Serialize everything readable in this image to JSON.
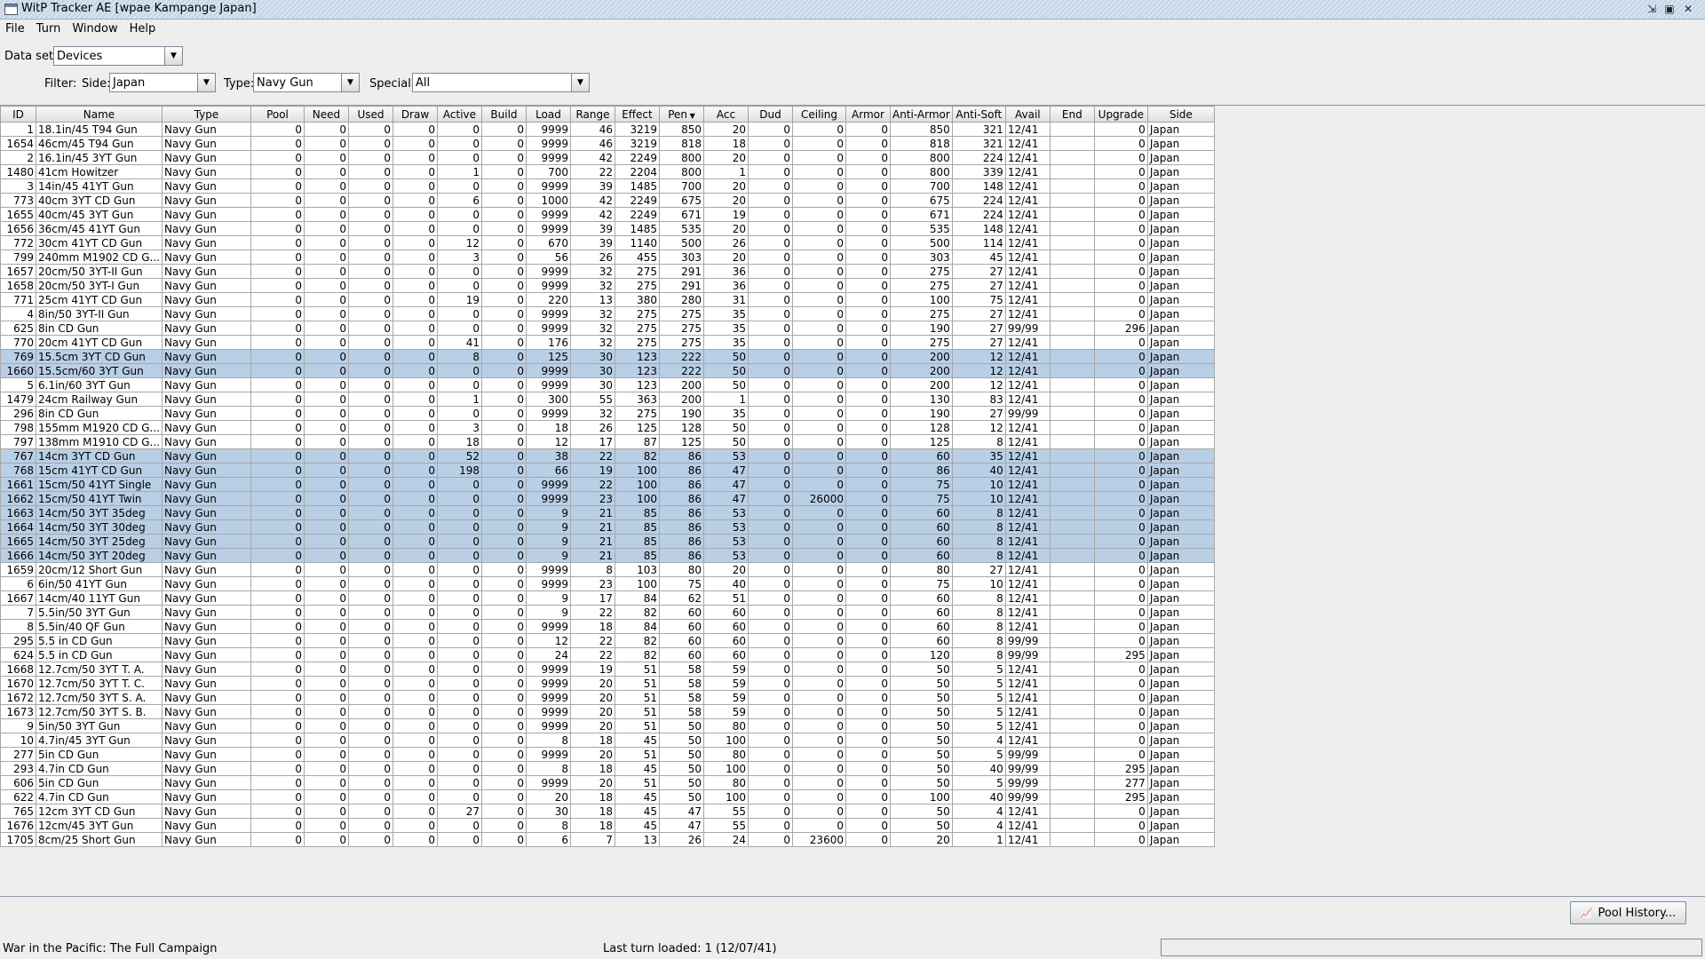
{
  "window": {
    "title": "WitP Tracker AE [wpae Kampange Japan]",
    "menus": [
      "File",
      "Turn",
      "Window",
      "Help"
    ]
  },
  "filters": {
    "dataset_label": "Data set:",
    "dataset_value": "Devices",
    "filter_label": "Filter:",
    "side_label": "Side:",
    "side_value": "Japan",
    "type_label": "Type:",
    "type_value": "Navy Gun",
    "special_label": "Special:",
    "special_value": "All"
  },
  "table": {
    "sort_column": "Pen",
    "columns": [
      "ID",
      "Name",
      "Type",
      "Pool",
      "Need",
      "Used",
      "Draw",
      "Active",
      "Build",
      "Load",
      "Range",
      "Effect",
      "Pen",
      "Acc",
      "Dud",
      "Ceiling",
      "Armor",
      "Anti-Armor",
      "Anti-Soft",
      "Avail",
      "End",
      "Upgrade",
      "Side"
    ],
    "rows": [
      [
        "1",
        "18.1in/45 T94 Gun",
        "Navy Gun",
        "0",
        "0",
        "0",
        "0",
        "0",
        "0",
        "9999",
        "46",
        "3219",
        "850",
        "20",
        "0",
        "0",
        "0",
        "850",
        "321",
        "12/41",
        "",
        "0",
        "Japan"
      ],
      [
        "1654",
        "46cm/45 T94 Gun",
        "Navy Gun",
        "0",
        "0",
        "0",
        "0",
        "0",
        "0",
        "9999",
        "46",
        "3219",
        "818",
        "18",
        "0",
        "0",
        "0",
        "818",
        "321",
        "12/41",
        "",
        "0",
        "Japan"
      ],
      [
        "2",
        "16.1in/45 3YT Gun",
        "Navy Gun",
        "0",
        "0",
        "0",
        "0",
        "0",
        "0",
        "9999",
        "42",
        "2249",
        "800",
        "20",
        "0",
        "0",
        "0",
        "800",
        "224",
        "12/41",
        "",
        "0",
        "Japan"
      ],
      [
        "1480",
        "41cm Howitzer",
        "Navy Gun",
        "0",
        "0",
        "0",
        "0",
        "1",
        "0",
        "700",
        "22",
        "2204",
        "800",
        "1",
        "0",
        "0",
        "0",
        "800",
        "339",
        "12/41",
        "",
        "0",
        "Japan"
      ],
      [
        "3",
        "14in/45 41YT Gun",
        "Navy Gun",
        "0",
        "0",
        "0",
        "0",
        "0",
        "0",
        "9999",
        "39",
        "1485",
        "700",
        "20",
        "0",
        "0",
        "0",
        "700",
        "148",
        "12/41",
        "",
        "0",
        "Japan"
      ],
      [
        "773",
        "40cm 3YT CD Gun",
        "Navy Gun",
        "0",
        "0",
        "0",
        "0",
        "6",
        "0",
        "1000",
        "42",
        "2249",
        "675",
        "20",
        "0",
        "0",
        "0",
        "675",
        "224",
        "12/41",
        "",
        "0",
        "Japan"
      ],
      [
        "1655",
        "40cm/45 3YT Gun",
        "Navy Gun",
        "0",
        "0",
        "0",
        "0",
        "0",
        "0",
        "9999",
        "42",
        "2249",
        "671",
        "19",
        "0",
        "0",
        "0",
        "671",
        "224",
        "12/41",
        "",
        "0",
        "Japan"
      ],
      [
        "1656",
        "36cm/45 41YT Gun",
        "Navy Gun",
        "0",
        "0",
        "0",
        "0",
        "0",
        "0",
        "9999",
        "39",
        "1485",
        "535",
        "20",
        "0",
        "0",
        "0",
        "535",
        "148",
        "12/41",
        "",
        "0",
        "Japan"
      ],
      [
        "772",
        "30cm 41YT CD Gun",
        "Navy Gun",
        "0",
        "0",
        "0",
        "0",
        "12",
        "0",
        "670",
        "39",
        "1140",
        "500",
        "26",
        "0",
        "0",
        "0",
        "500",
        "114",
        "12/41",
        "",
        "0",
        "Japan"
      ],
      [
        "799",
        "240mm M1902 CD G...",
        "Navy Gun",
        "0",
        "0",
        "0",
        "0",
        "3",
        "0",
        "56",
        "26",
        "455",
        "303",
        "20",
        "0",
        "0",
        "0",
        "303",
        "45",
        "12/41",
        "",
        "0",
        "Japan"
      ],
      [
        "1657",
        "20cm/50 3YT-II Gun",
        "Navy Gun",
        "0",
        "0",
        "0",
        "0",
        "0",
        "0",
        "9999",
        "32",
        "275",
        "291",
        "36",
        "0",
        "0",
        "0",
        "275",
        "27",
        "12/41",
        "",
        "0",
        "Japan"
      ],
      [
        "1658",
        "20cm/50 3YT-I Gun",
        "Navy Gun",
        "0",
        "0",
        "0",
        "0",
        "0",
        "0",
        "9999",
        "32",
        "275",
        "291",
        "36",
        "0",
        "0",
        "0",
        "275",
        "27",
        "12/41",
        "",
        "0",
        "Japan"
      ],
      [
        "771",
        "25cm 41YT CD Gun",
        "Navy Gun",
        "0",
        "0",
        "0",
        "0",
        "19",
        "0",
        "220",
        "13",
        "380",
        "280",
        "31",
        "0",
        "0",
        "0",
        "100",
        "75",
        "12/41",
        "",
        "0",
        "Japan"
      ],
      [
        "4",
        "8in/50 3YT-II Gun",
        "Navy Gun",
        "0",
        "0",
        "0",
        "0",
        "0",
        "0",
        "9999",
        "32",
        "275",
        "275",
        "35",
        "0",
        "0",
        "0",
        "275",
        "27",
        "12/41",
        "",
        "0",
        "Japan"
      ],
      [
        "625",
        "8in CD Gun",
        "Navy Gun",
        "0",
        "0",
        "0",
        "0",
        "0",
        "0",
        "9999",
        "32",
        "275",
        "275",
        "35",
        "0",
        "0",
        "0",
        "190",
        "27",
        "99/99",
        "",
        "296",
        "Japan"
      ],
      [
        "770",
        "20cm 41YT CD Gun",
        "Navy Gun",
        "0",
        "0",
        "0",
        "0",
        "41",
        "0",
        "176",
        "32",
        "275",
        "275",
        "35",
        "0",
        "0",
        "0",
        "275",
        "27",
        "12/41",
        "",
        "0",
        "Japan"
      ],
      [
        "769",
        "15.5cm 3YT CD Gun",
        "Navy Gun",
        "0",
        "0",
        "0",
        "0",
        "8",
        "0",
        "125",
        "30",
        "123",
        "222",
        "50",
        "0",
        "0",
        "0",
        "200",
        "12",
        "12/41",
        "",
        "0",
        "Japan"
      ],
      [
        "1660",
        "15.5cm/60 3YT Gun",
        "Navy Gun",
        "0",
        "0",
        "0",
        "0",
        "0",
        "0",
        "9999",
        "30",
        "123",
        "222",
        "50",
        "0",
        "0",
        "0",
        "200",
        "12",
        "12/41",
        "",
        "0",
        "Japan"
      ],
      [
        "5",
        "6.1in/60 3YT Gun",
        "Navy Gun",
        "0",
        "0",
        "0",
        "0",
        "0",
        "0",
        "9999",
        "30",
        "123",
        "200",
        "50",
        "0",
        "0",
        "0",
        "200",
        "12",
        "12/41",
        "",
        "0",
        "Japan"
      ],
      [
        "1479",
        "24cm Railway Gun",
        "Navy Gun",
        "0",
        "0",
        "0",
        "0",
        "1",
        "0",
        "300",
        "55",
        "363",
        "200",
        "1",
        "0",
        "0",
        "0",
        "130",
        "83",
        "12/41",
        "",
        "0",
        "Japan"
      ],
      [
        "296",
        "8in CD Gun",
        "Navy Gun",
        "0",
        "0",
        "0",
        "0",
        "0",
        "0",
        "9999",
        "32",
        "275",
        "190",
        "35",
        "0",
        "0",
        "0",
        "190",
        "27",
        "99/99",
        "",
        "0",
        "Japan"
      ],
      [
        "798",
        "155mm M1920 CD G...",
        "Navy Gun",
        "0",
        "0",
        "0",
        "0",
        "3",
        "0",
        "18",
        "26",
        "125",
        "128",
        "50",
        "0",
        "0",
        "0",
        "128",
        "12",
        "12/41",
        "",
        "0",
        "Japan"
      ],
      [
        "797",
        "138mm M1910 CD G...",
        "Navy Gun",
        "0",
        "0",
        "0",
        "0",
        "18",
        "0",
        "12",
        "17",
        "87",
        "125",
        "50",
        "0",
        "0",
        "0",
        "125",
        "8",
        "12/41",
        "",
        "0",
        "Japan"
      ],
      [
        "767",
        "14cm 3YT CD Gun",
        "Navy Gun",
        "0",
        "0",
        "0",
        "0",
        "52",
        "0",
        "38",
        "22",
        "82",
        "86",
        "53",
        "0",
        "0",
        "0",
        "60",
        "35",
        "12/41",
        "",
        "0",
        "Japan"
      ],
      [
        "768",
        "15cm 41YT CD Gun",
        "Navy Gun",
        "0",
        "0",
        "0",
        "0",
        "198",
        "0",
        "66",
        "19",
        "100",
        "86",
        "47",
        "0",
        "0",
        "0",
        "86",
        "40",
        "12/41",
        "",
        "0",
        "Japan"
      ],
      [
        "1661",
        "15cm/50 41YT Single",
        "Navy Gun",
        "0",
        "0",
        "0",
        "0",
        "0",
        "0",
        "9999",
        "22",
        "100",
        "86",
        "47",
        "0",
        "0",
        "0",
        "75",
        "10",
        "12/41",
        "",
        "0",
        "Japan"
      ],
      [
        "1662",
        "15cm/50 41YT Twin",
        "Navy Gun",
        "0",
        "0",
        "0",
        "0",
        "0",
        "0",
        "9999",
        "23",
        "100",
        "86",
        "47",
        "0",
        "26000",
        "0",
        "75",
        "10",
        "12/41",
        "",
        "0",
        "Japan"
      ],
      [
        "1663",
        "14cm/50 3YT 35deg",
        "Navy Gun",
        "0",
        "0",
        "0",
        "0",
        "0",
        "0",
        "9",
        "21",
        "85",
        "86",
        "53",
        "0",
        "0",
        "0",
        "60",
        "8",
        "12/41",
        "",
        "0",
        "Japan"
      ],
      [
        "1664",
        "14cm/50 3YT 30deg",
        "Navy Gun",
        "0",
        "0",
        "0",
        "0",
        "0",
        "0",
        "9",
        "21",
        "85",
        "86",
        "53",
        "0",
        "0",
        "0",
        "60",
        "8",
        "12/41",
        "",
        "0",
        "Japan"
      ],
      [
        "1665",
        "14cm/50 3YT 25deg",
        "Navy Gun",
        "0",
        "0",
        "0",
        "0",
        "0",
        "0",
        "9",
        "21",
        "85",
        "86",
        "53",
        "0",
        "0",
        "0",
        "60",
        "8",
        "12/41",
        "",
        "0",
        "Japan"
      ],
      [
        "1666",
        "14cm/50 3YT 20deg",
        "Navy Gun",
        "0",
        "0",
        "0",
        "0",
        "0",
        "0",
        "9",
        "21",
        "85",
        "86",
        "53",
        "0",
        "0",
        "0",
        "60",
        "8",
        "12/41",
        "",
        "0",
        "Japan"
      ],
      [
        "1659",
        "20cm/12 Short Gun",
        "Navy Gun",
        "0",
        "0",
        "0",
        "0",
        "0",
        "0",
        "9999",
        "8",
        "103",
        "80",
        "20",
        "0",
        "0",
        "0",
        "80",
        "27",
        "12/41",
        "",
        "0",
        "Japan"
      ],
      [
        "6",
        "6in/50 41YT Gun",
        "Navy Gun",
        "0",
        "0",
        "0",
        "0",
        "0",
        "0",
        "9999",
        "23",
        "100",
        "75",
        "40",
        "0",
        "0",
        "0",
        "75",
        "10",
        "12/41",
        "",
        "0",
        "Japan"
      ],
      [
        "1667",
        "14cm/40 11YT Gun",
        "Navy Gun",
        "0",
        "0",
        "0",
        "0",
        "0",
        "0",
        "9",
        "17",
        "84",
        "62",
        "51",
        "0",
        "0",
        "0",
        "60",
        "8",
        "12/41",
        "",
        "0",
        "Japan"
      ],
      [
        "7",
        "5.5in/50 3YT Gun",
        "Navy Gun",
        "0",
        "0",
        "0",
        "0",
        "0",
        "0",
        "9",
        "22",
        "82",
        "60",
        "60",
        "0",
        "0",
        "0",
        "60",
        "8",
        "12/41",
        "",
        "0",
        "Japan"
      ],
      [
        "8",
        "5.5in/40 QF Gun",
        "Navy Gun",
        "0",
        "0",
        "0",
        "0",
        "0",
        "0",
        "9999",
        "18",
        "84",
        "60",
        "60",
        "0",
        "0",
        "0",
        "60",
        "8",
        "12/41",
        "",
        "0",
        "Japan"
      ],
      [
        "295",
        "5.5 in CD Gun",
        "Navy Gun",
        "0",
        "0",
        "0",
        "0",
        "0",
        "0",
        "12",
        "22",
        "82",
        "60",
        "60",
        "0",
        "0",
        "0",
        "60",
        "8",
        "99/99",
        "",
        "0",
        "Japan"
      ],
      [
        "624",
        "5.5 in CD Gun",
        "Navy Gun",
        "0",
        "0",
        "0",
        "0",
        "0",
        "0",
        "24",
        "22",
        "82",
        "60",
        "60",
        "0",
        "0",
        "0",
        "120",
        "8",
        "99/99",
        "",
        "295",
        "Japan"
      ],
      [
        "1668",
        "12.7cm/50 3YT T. A.",
        "Navy Gun",
        "0",
        "0",
        "0",
        "0",
        "0",
        "0",
        "9999",
        "19",
        "51",
        "58",
        "59",
        "0",
        "0",
        "0",
        "50",
        "5",
        "12/41",
        "",
        "0",
        "Japan"
      ],
      [
        "1670",
        "12.7cm/50 3YT T. C.",
        "Navy Gun",
        "0",
        "0",
        "0",
        "0",
        "0",
        "0",
        "9999",
        "20",
        "51",
        "58",
        "59",
        "0",
        "0",
        "0",
        "50",
        "5",
        "12/41",
        "",
        "0",
        "Japan"
      ],
      [
        "1672",
        "12.7cm/50 3YT S. A.",
        "Navy Gun",
        "0",
        "0",
        "0",
        "0",
        "0",
        "0",
        "9999",
        "20",
        "51",
        "58",
        "59",
        "0",
        "0",
        "0",
        "50",
        "5",
        "12/41",
        "",
        "0",
        "Japan"
      ],
      [
        "1673",
        "12.7cm/50 3YT S. B.",
        "Navy Gun",
        "0",
        "0",
        "0",
        "0",
        "0",
        "0",
        "9999",
        "20",
        "51",
        "58",
        "59",
        "0",
        "0",
        "0",
        "50",
        "5",
        "12/41",
        "",
        "0",
        "Japan"
      ],
      [
        "9",
        "5in/50 3YT Gun",
        "Navy Gun",
        "0",
        "0",
        "0",
        "0",
        "0",
        "0",
        "9999",
        "20",
        "51",
        "50",
        "80",
        "0",
        "0",
        "0",
        "50",
        "5",
        "12/41",
        "",
        "0",
        "Japan"
      ],
      [
        "10",
        "4.7in/45 3YT Gun",
        "Navy Gun",
        "0",
        "0",
        "0",
        "0",
        "0",
        "0",
        "8",
        "18",
        "45",
        "50",
        "100",
        "0",
        "0",
        "0",
        "50",
        "4",
        "12/41",
        "",
        "0",
        "Japan"
      ],
      [
        "277",
        "5in CD Gun",
        "Navy Gun",
        "0",
        "0",
        "0",
        "0",
        "0",
        "0",
        "9999",
        "20",
        "51",
        "50",
        "80",
        "0",
        "0",
        "0",
        "50",
        "5",
        "99/99",
        "",
        "0",
        "Japan"
      ],
      [
        "293",
        "4.7in CD Gun",
        "Navy Gun",
        "0",
        "0",
        "0",
        "0",
        "0",
        "0",
        "8",
        "18",
        "45",
        "50",
        "100",
        "0",
        "0",
        "0",
        "50",
        "40",
        "99/99",
        "",
        "295",
        "Japan"
      ],
      [
        "606",
        "5in CD Gun",
        "Navy Gun",
        "0",
        "0",
        "0",
        "0",
        "0",
        "0",
        "9999",
        "20",
        "51",
        "50",
        "80",
        "0",
        "0",
        "0",
        "50",
        "5",
        "99/99",
        "",
        "277",
        "Japan"
      ],
      [
        "622",
        "4.7in CD Gun",
        "Navy Gun",
        "0",
        "0",
        "0",
        "0",
        "0",
        "0",
        "20",
        "18",
        "45",
        "50",
        "100",
        "0",
        "0",
        "0",
        "100",
        "40",
        "99/99",
        "",
        "295",
        "Japan"
      ],
      [
        "765",
        "12cm 3YT CD Gun",
        "Navy Gun",
        "0",
        "0",
        "0",
        "0",
        "27",
        "0",
        "30",
        "18",
        "45",
        "47",
        "55",
        "0",
        "0",
        "0",
        "50",
        "4",
        "12/41",
        "",
        "0",
        "Japan"
      ],
      [
        "1676",
        "12cm/45 3YT Gun",
        "Navy Gun",
        "0",
        "0",
        "0",
        "0",
        "0",
        "0",
        "8",
        "18",
        "45",
        "47",
        "55",
        "0",
        "0",
        "0",
        "50",
        "4",
        "12/41",
        "",
        "0",
        "Japan"
      ],
      [
        "1705",
        "8cm/25 Short Gun",
        "Navy Gun",
        "0",
        "0",
        "0",
        "0",
        "0",
        "0",
        "6",
        "7",
        "13",
        "26",
        "24",
        "0",
        "23600",
        "0",
        "20",
        "1",
        "12/41",
        "",
        "0",
        "Japan"
      ]
    ],
    "selected_rows": [
      16,
      17,
      23,
      24,
      25,
      26,
      27,
      28,
      29,
      30
    ]
  },
  "buttons": {
    "pool_history": "Pool History..."
  },
  "status": {
    "left": "War in the Pacific: The Full Campaign",
    "middle": "Last turn loaded: 1 (12/07/41)"
  },
  "icons": {
    "app": "app-window-icon",
    "pool_history": "chart-icon"
  }
}
